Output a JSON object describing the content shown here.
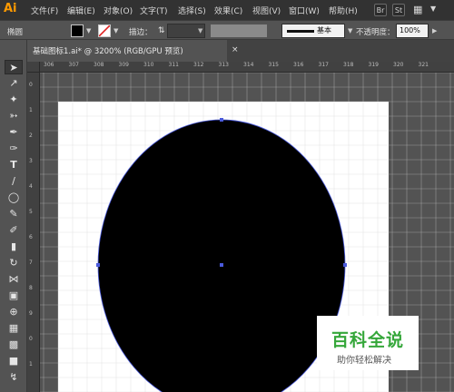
{
  "app": {
    "logo": "Ai"
  },
  "menubar": {
    "items": [
      "文件(F)",
      "编辑(E)",
      "对象(O)",
      "文字(T)",
      "选择(S)",
      "效果(C)",
      "视图(V)",
      "窗口(W)",
      "帮助(H)"
    ],
    "app_icons": [
      "Br",
      "St"
    ]
  },
  "controlbar": {
    "object_type": "椭圆",
    "stroke_label": "描边：",
    "stroke_profile": "基本",
    "opacity_label": "不透明度：",
    "opacity_value": "100%",
    "fill_color": "#000000"
  },
  "document_tab": {
    "title": "基础图标1.ai* @ 3200% (RGB/GPU 预览)",
    "close": "×"
  },
  "rulers": {
    "top": [
      "306",
      "307",
      "308",
      "309",
      "310",
      "311",
      "312",
      "313",
      "314",
      "315",
      "316",
      "317",
      "318",
      "319",
      "320",
      "321"
    ],
    "left": [
      "0",
      "1",
      "2",
      "3",
      "4",
      "5",
      "6",
      "7",
      "8",
      "9",
      "0",
      "1"
    ]
  },
  "tools": [
    "selection-tool",
    "direct-selection-tool",
    "magic-wand-tool",
    "lasso-tool",
    "pen-tool",
    "curvature-tool",
    "type-tool",
    "line-tool",
    "ellipse-tool",
    "paintbrush-tool",
    "blob-brush-tool",
    "eraser-tool",
    "rotate-tool",
    "width-tool",
    "free-transform-tool",
    "shape-builder-tool",
    "perspective-tool",
    "mesh-tool",
    "gradient-tool",
    "eyedropper-tool",
    "blend-tool",
    "symbol-sprayer-tool",
    "column-graph-tool",
    "artboard-tool",
    "slice-tool"
  ],
  "artwork": {
    "shape": "ellipse",
    "fill": "#000000",
    "selection_color": "#4a5adc"
  },
  "watermark": {
    "title": "百科全说",
    "subtitle": "助你轻松解决",
    "color": "#35a73a"
  }
}
